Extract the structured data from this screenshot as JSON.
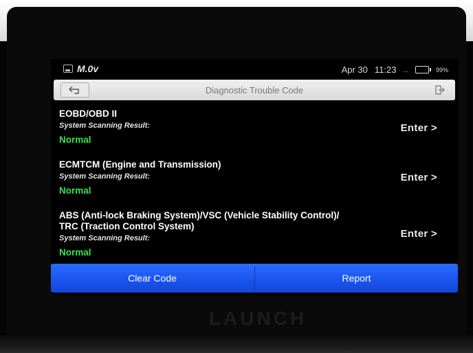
{
  "device": {
    "brand": "LAUNCH"
  },
  "status_bar": {
    "voltage": "M.0v",
    "date": "Apr 30",
    "time": "11:23",
    "signal": "...",
    "battery_pct": "99%"
  },
  "header": {
    "title": "Diagnostic Trouble Code"
  },
  "systems": [
    {
      "title": "EOBD/OBD II",
      "result_label": "System Scanning Result:",
      "status": "Normal",
      "enter_label": "Enter >"
    },
    {
      "title": "ECMTCM (Engine and Transmission)",
      "result_label": "System Scanning Result:",
      "status": "Normal",
      "enter_label": "Enter >"
    },
    {
      "title_line1": "ABS (Anti-lock Braking System)/VSC (Vehicle Stability Control)/",
      "title_line2": "TRC (Traction Control System)",
      "result_label": "System Scanning Result:",
      "status": "Normal",
      "enter_label": "Enter >"
    }
  ],
  "footer": {
    "clear_label": "Clear Code",
    "report_label": "Report"
  },
  "colors": {
    "status_normal": "#34e24a",
    "action_bar": "#1a55f0"
  }
}
